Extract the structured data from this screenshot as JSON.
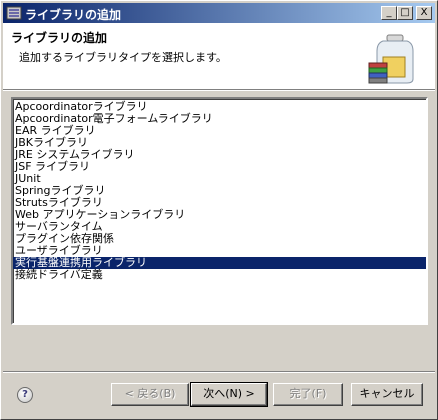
{
  "window": {
    "title": "ライブラリの追加",
    "controls": {
      "minimize": "_",
      "maximize": "□",
      "close": "X"
    }
  },
  "header": {
    "title": "ライブラリの追加",
    "description": "追加するライブラリタイプを選択します。",
    "icon": "library-jar-icon"
  },
  "library_list": {
    "items": [
      {
        "label": "Apcoordinatorライブラリ",
        "selected": false
      },
      {
        "label": "Apcoordinator電子フォームライブラリ",
        "selected": false
      },
      {
        "label": "EAR ライブラリ",
        "selected": false
      },
      {
        "label": "JBKライブラリ",
        "selected": false
      },
      {
        "label": "JRE システムライブラリ",
        "selected": false
      },
      {
        "label": "JSF ライブラリ",
        "selected": false
      },
      {
        "label": "JUnit",
        "selected": false
      },
      {
        "label": "Springライブラリ",
        "selected": false
      },
      {
        "label": "Strutsライブラリ",
        "selected": false
      },
      {
        "label": "Web アプリケーションライブラリ",
        "selected": false
      },
      {
        "label": "サーバランタイム",
        "selected": false
      },
      {
        "label": "プラグイン依存関係",
        "selected": false
      },
      {
        "label": "ユーザライブラリ",
        "selected": false
      },
      {
        "label": "実行基盤連携用ライブラリ",
        "selected": true
      },
      {
        "label": "接続ドライバ定義",
        "selected": false
      }
    ],
    "selection_color": "#0a246a"
  },
  "footer": {
    "help_icon": "help-icon",
    "help_glyph": "?",
    "back_label": "< 戻る(B)",
    "next_label": "次へ(N) >",
    "finish_label": "完了(F)",
    "cancel_label": "キャンセル"
  }
}
